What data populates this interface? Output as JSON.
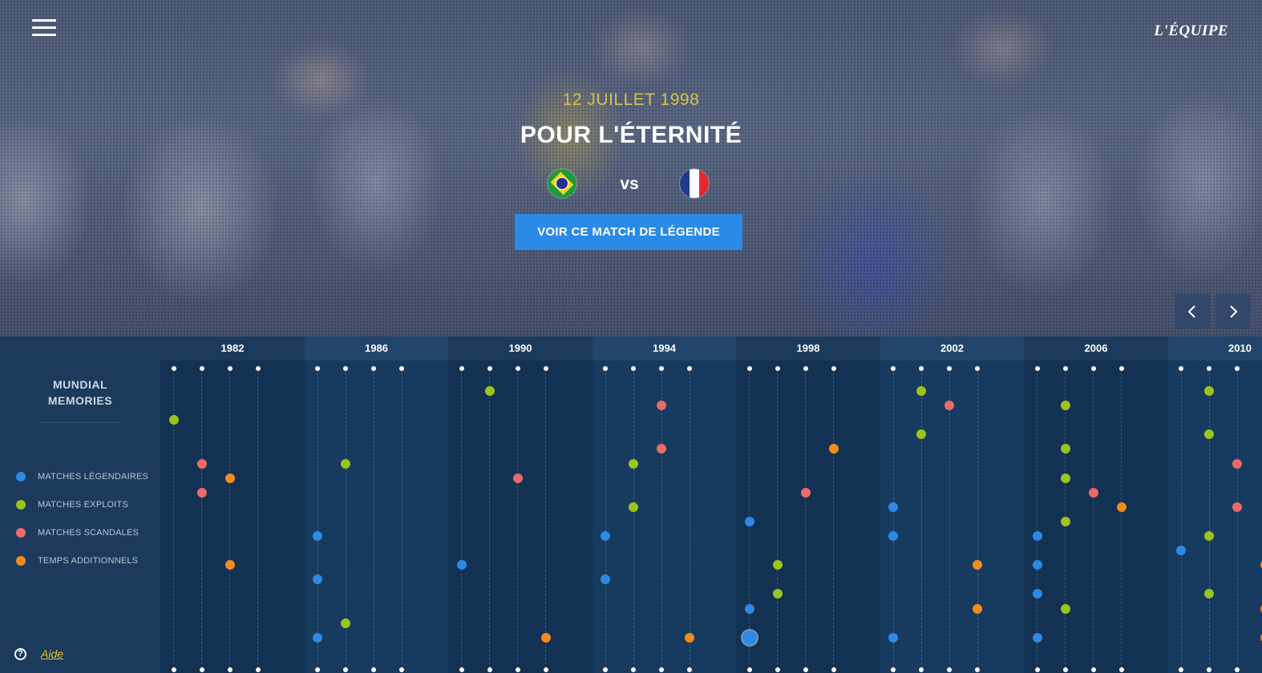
{
  "header": {
    "menu_icon": "hamburger-menu-icon",
    "logo": "L'ÉQUIPE"
  },
  "hero": {
    "date": "12 JUILLET 1998",
    "title": "POUR L'ÉTERNITÉ",
    "team_home": "Brazil",
    "team_away": "France",
    "vs": "vs",
    "cta": "VOIR CE MATCH DE LÉGENDE",
    "prev_icon": "chevron-left-icon",
    "next_icon": "chevron-right-icon"
  },
  "sidebar": {
    "brand_line1": "MUNDIAL",
    "brand_line2": "MEMORIES",
    "legend": [
      {
        "label": "MATCHES LÉGENDAIRES",
        "color": "#2b8ae6"
      },
      {
        "label": "MATCHES EXPLOITS",
        "color": "#9bc41c"
      },
      {
        "label": "MATCHES SCANDALES",
        "color": "#ee6a66"
      },
      {
        "label": "TEMPS ADDITIONNELS",
        "color": "#f18c1e"
      }
    ],
    "help_label": "Aide"
  },
  "colors": {
    "legendaire": "#2b8ae6",
    "exploit": "#9bc41c",
    "scandale": "#ee6a66",
    "temps": "#f18c1e"
  },
  "timeline": {
    "years": [
      "1982",
      "1986",
      "1990",
      "1994",
      "1998",
      "2002",
      "2006",
      "2010"
    ],
    "selected": {
      "year": "1998",
      "track": 0,
      "row": 19
    },
    "matches": [
      {
        "year": "1982",
        "track": 0,
        "row": 4,
        "type": "exploit"
      },
      {
        "year": "1982",
        "track": 1,
        "row": 7,
        "type": "scandale"
      },
      {
        "year": "1982",
        "track": 1,
        "row": 9,
        "type": "scandale"
      },
      {
        "year": "1982",
        "track": 2,
        "row": 8,
        "type": "temps"
      },
      {
        "year": "1982",
        "track": 2,
        "row": 14,
        "type": "temps"
      },
      {
        "year": "1986",
        "track": 0,
        "row": 12,
        "type": "legendaire"
      },
      {
        "year": "1986",
        "track": 0,
        "row": 15,
        "type": "legendaire"
      },
      {
        "year": "1986",
        "track": 0,
        "row": 19,
        "type": "legendaire"
      },
      {
        "year": "1986",
        "track": 1,
        "row": 7,
        "type": "exploit"
      },
      {
        "year": "1986",
        "track": 1,
        "row": 18,
        "type": "exploit"
      },
      {
        "year": "1990",
        "track": 0,
        "row": 14,
        "type": "legendaire"
      },
      {
        "year": "1990",
        "track": 1,
        "row": 2,
        "type": "exploit"
      },
      {
        "year": "1990",
        "track": 2,
        "row": 8,
        "type": "scandale"
      },
      {
        "year": "1990",
        "track": 3,
        "row": 19,
        "type": "temps"
      },
      {
        "year": "1994",
        "track": 0,
        "row": 12,
        "type": "legendaire"
      },
      {
        "year": "1994",
        "track": 0,
        "row": 15,
        "type": "legendaire"
      },
      {
        "year": "1994",
        "track": 1,
        "row": 7,
        "type": "exploit"
      },
      {
        "year": "1994",
        "track": 1,
        "row": 10,
        "type": "exploit"
      },
      {
        "year": "1994",
        "track": 2,
        "row": 3,
        "type": "scandale"
      },
      {
        "year": "1994",
        "track": 2,
        "row": 6,
        "type": "scandale"
      },
      {
        "year": "1994",
        "track": 3,
        "row": 19,
        "type": "temps"
      },
      {
        "year": "1998",
        "track": 0,
        "row": 11,
        "type": "legendaire"
      },
      {
        "year": "1998",
        "track": 0,
        "row": 17,
        "type": "legendaire"
      },
      {
        "year": "1998",
        "track": 0,
        "row": 19,
        "type": "legendaire"
      },
      {
        "year": "1998",
        "track": 1,
        "row": 14,
        "type": "exploit"
      },
      {
        "year": "1998",
        "track": 1,
        "row": 16,
        "type": "exploit"
      },
      {
        "year": "1998",
        "track": 2,
        "row": 9,
        "type": "scandale"
      },
      {
        "year": "1998",
        "track": 3,
        "row": 6,
        "type": "temps"
      },
      {
        "year": "2002",
        "track": 0,
        "row": 10,
        "type": "legendaire"
      },
      {
        "year": "2002",
        "track": 0,
        "row": 12,
        "type": "legendaire"
      },
      {
        "year": "2002",
        "track": 0,
        "row": 19,
        "type": "legendaire"
      },
      {
        "year": "2002",
        "track": 1,
        "row": 2,
        "type": "exploit"
      },
      {
        "year": "2002",
        "track": 1,
        "row": 5,
        "type": "exploit"
      },
      {
        "year": "2002",
        "track": 2,
        "row": 3,
        "type": "scandale"
      },
      {
        "year": "2002",
        "track": 3,
        "row": 14,
        "type": "temps"
      },
      {
        "year": "2002",
        "track": 3,
        "row": 17,
        "type": "temps"
      },
      {
        "year": "2006",
        "track": 0,
        "row": 12,
        "type": "legendaire"
      },
      {
        "year": "2006",
        "track": 0,
        "row": 14,
        "type": "legendaire"
      },
      {
        "year": "2006",
        "track": 0,
        "row": 16,
        "type": "legendaire"
      },
      {
        "year": "2006",
        "track": 0,
        "row": 19,
        "type": "legendaire"
      },
      {
        "year": "2006",
        "track": 1,
        "row": 3,
        "type": "exploit"
      },
      {
        "year": "2006",
        "track": 1,
        "row": 6,
        "type": "exploit"
      },
      {
        "year": "2006",
        "track": 1,
        "row": 8,
        "type": "exploit"
      },
      {
        "year": "2006",
        "track": 1,
        "row": 11,
        "type": "exploit"
      },
      {
        "year": "2006",
        "track": 1,
        "row": 17,
        "type": "exploit"
      },
      {
        "year": "2006",
        "track": 2,
        "row": 9,
        "type": "scandale"
      },
      {
        "year": "2006",
        "track": 3,
        "row": 10,
        "type": "temps"
      },
      {
        "year": "2010",
        "track": 0,
        "row": 13,
        "type": "legendaire"
      },
      {
        "year": "2010",
        "track": 1,
        "row": 2,
        "type": "exploit"
      },
      {
        "year": "2010",
        "track": 1,
        "row": 5,
        "type": "exploit"
      },
      {
        "year": "2010",
        "track": 1,
        "row": 12,
        "type": "exploit"
      },
      {
        "year": "2010",
        "track": 1,
        "row": 16,
        "type": "exploit"
      },
      {
        "year": "2010",
        "track": 2,
        "row": 7,
        "type": "scandale"
      },
      {
        "year": "2010",
        "track": 2,
        "row": 10,
        "type": "scandale"
      },
      {
        "year": "2010",
        "track": 3,
        "row": 14,
        "type": "temps"
      },
      {
        "year": "2010",
        "track": 3,
        "row": 17,
        "type": "temps"
      },
      {
        "year": "2010",
        "track": 3,
        "row": 19,
        "type": "temps"
      }
    ]
  }
}
